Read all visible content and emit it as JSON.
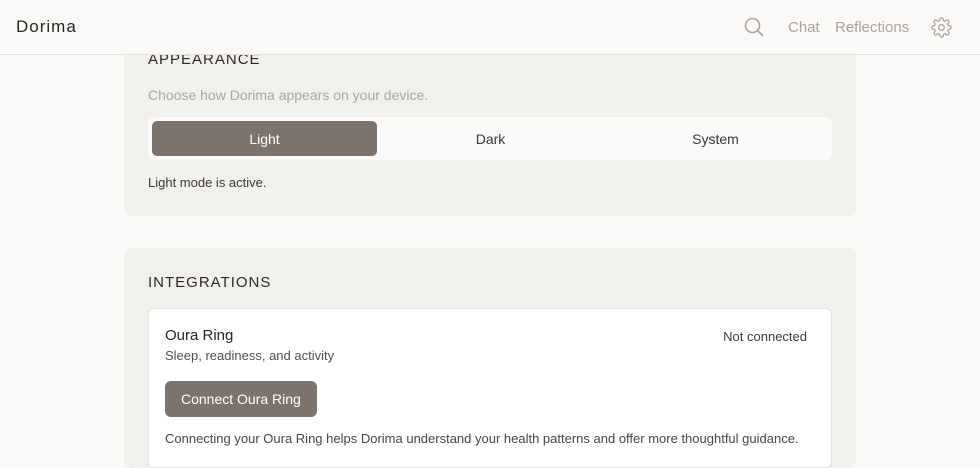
{
  "header": {
    "brand": "Dorima",
    "search_icon": "search-icon",
    "nav": {
      "chat": "Chat",
      "reflections": "Reflections"
    },
    "settings_icon": "gear-icon"
  },
  "appearance": {
    "title": "APPEARANCE",
    "description": "Choose how Dorima appears on your device.",
    "options": [
      "Light",
      "Dark",
      "System"
    ],
    "selected": "Light",
    "status": "Light mode is active.",
    "accent_color": "#7b736c"
  },
  "integrations": {
    "title": "INTEGRATIONS",
    "items": [
      {
        "name": "Oura Ring",
        "subtitle": "Sleep, readiness, and activity",
        "status": "Not connected",
        "button_label": "Connect Oura Ring",
        "note": "Connecting your Oura Ring helps Dorima understand your health patterns and offer more thoughtful guidance."
      }
    ]
  }
}
